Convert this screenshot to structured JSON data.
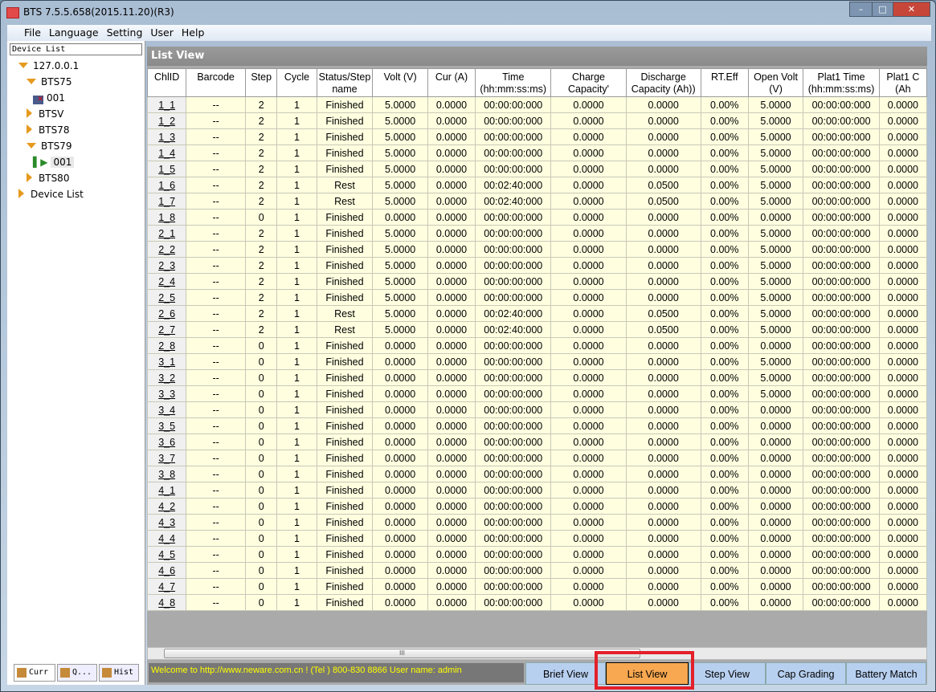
{
  "window": {
    "title": "BTS 7.5.5.658(2015.11.20)(R3)"
  },
  "menu": [
    "File",
    "Language",
    "Setting",
    "User",
    "Help"
  ],
  "sidebar": {
    "header": "Device List",
    "tree": [
      {
        "label": "127.0.0.1",
        "level": 0,
        "state": "expanded"
      },
      {
        "label": "BTS75",
        "level": 1,
        "state": "expanded"
      },
      {
        "label": "001",
        "level": 2,
        "state": "offline"
      },
      {
        "label": "BTSV",
        "level": 1,
        "state": "collapsed"
      },
      {
        "label": "BTS78",
        "level": 1,
        "state": "collapsed"
      },
      {
        "label": "BTS79",
        "level": 1,
        "state": "expanded"
      },
      {
        "label": "001",
        "level": 2,
        "state": "running-selected"
      },
      {
        "label": "BTS80",
        "level": 1,
        "state": "collapsed"
      },
      {
        "label": "Device List",
        "level": 0,
        "state": "collapsed"
      }
    ],
    "tabs": [
      "Curr",
      "Q...",
      "Hist"
    ]
  },
  "panel": {
    "title": "List View"
  },
  "table": {
    "columns": [
      "ChlID",
      "Barcode",
      "Step",
      "Cycle",
      "Status/Step name",
      "Volt (V)",
      "Cur (A)",
      "Time (hh:mm:ss:ms)",
      "Charge Capacity'",
      "Discharge Capacity (Ah))",
      "RT.Eff",
      "Open Volt (V)",
      "Plat1 Time (hh:mm:ss:ms)",
      "Plat1 C (Ah"
    ],
    "rows": [
      [
        "1_1",
        "--",
        "2",
        "1",
        "Finished",
        "5.0000",
        "0.0000",
        "00:00:00:000",
        "0.0000",
        "0.0000",
        "0.00%",
        "5.0000",
        "00:00:00:000",
        "0.0000"
      ],
      [
        "1_2",
        "--",
        "2",
        "1",
        "Finished",
        "5.0000",
        "0.0000",
        "00:00:00:000",
        "0.0000",
        "0.0000",
        "0.00%",
        "5.0000",
        "00:00:00:000",
        "0.0000"
      ],
      [
        "1_3",
        "--",
        "2",
        "1",
        "Finished",
        "5.0000",
        "0.0000",
        "00:00:00:000",
        "0.0000",
        "0.0000",
        "0.00%",
        "5.0000",
        "00:00:00:000",
        "0.0000"
      ],
      [
        "1_4",
        "--",
        "2",
        "1",
        "Finished",
        "5.0000",
        "0.0000",
        "00:00:00:000",
        "0.0000",
        "0.0000",
        "0.00%",
        "5.0000",
        "00:00:00:000",
        "0.0000"
      ],
      [
        "1_5",
        "--",
        "2",
        "1",
        "Finished",
        "5.0000",
        "0.0000",
        "00:00:00:000",
        "0.0000",
        "0.0000",
        "0.00%",
        "5.0000",
        "00:00:00:000",
        "0.0000"
      ],
      [
        "1_6",
        "--",
        "2",
        "1",
        "Rest",
        "5.0000",
        "0.0000",
        "00:02:40:000",
        "0.0000",
        "0.0500",
        "0.00%",
        "5.0000",
        "00:00:00:000",
        "0.0000"
      ],
      [
        "1_7",
        "--",
        "2",
        "1",
        "Rest",
        "5.0000",
        "0.0000",
        "00:02:40:000",
        "0.0000",
        "0.0500",
        "0.00%",
        "5.0000",
        "00:00:00:000",
        "0.0000"
      ],
      [
        "1_8",
        "--",
        "0",
        "1",
        "Finished",
        "0.0000",
        "0.0000",
        "00:00:00:000",
        "0.0000",
        "0.0000",
        "0.00%",
        "0.0000",
        "00:00:00:000",
        "0.0000"
      ],
      [
        "2_1",
        "--",
        "2",
        "1",
        "Finished",
        "5.0000",
        "0.0000",
        "00:00:00:000",
        "0.0000",
        "0.0000",
        "0.00%",
        "5.0000",
        "00:00:00:000",
        "0.0000"
      ],
      [
        "2_2",
        "--",
        "2",
        "1",
        "Finished",
        "5.0000",
        "0.0000",
        "00:00:00:000",
        "0.0000",
        "0.0000",
        "0.00%",
        "5.0000",
        "00:00:00:000",
        "0.0000"
      ],
      [
        "2_3",
        "--",
        "2",
        "1",
        "Finished",
        "5.0000",
        "0.0000",
        "00:00:00:000",
        "0.0000",
        "0.0000",
        "0.00%",
        "5.0000",
        "00:00:00:000",
        "0.0000"
      ],
      [
        "2_4",
        "--",
        "2",
        "1",
        "Finished",
        "5.0000",
        "0.0000",
        "00:00:00:000",
        "0.0000",
        "0.0000",
        "0.00%",
        "5.0000",
        "00:00:00:000",
        "0.0000"
      ],
      [
        "2_5",
        "--",
        "2",
        "1",
        "Finished",
        "5.0000",
        "0.0000",
        "00:00:00:000",
        "0.0000",
        "0.0000",
        "0.00%",
        "5.0000",
        "00:00:00:000",
        "0.0000"
      ],
      [
        "2_6",
        "--",
        "2",
        "1",
        "Rest",
        "5.0000",
        "0.0000",
        "00:02:40:000",
        "0.0000",
        "0.0500",
        "0.00%",
        "5.0000",
        "00:00:00:000",
        "0.0000"
      ],
      [
        "2_7",
        "--",
        "2",
        "1",
        "Rest",
        "5.0000",
        "0.0000",
        "00:02:40:000",
        "0.0000",
        "0.0500",
        "0.00%",
        "5.0000",
        "00:00:00:000",
        "0.0000"
      ],
      [
        "2_8",
        "--",
        "0",
        "1",
        "Finished",
        "0.0000",
        "0.0000",
        "00:00:00:000",
        "0.0000",
        "0.0000",
        "0.00%",
        "0.0000",
        "00:00:00:000",
        "0.0000"
      ],
      [
        "3_1",
        "--",
        "0",
        "1",
        "Finished",
        "0.0000",
        "0.0000",
        "00:00:00:000",
        "0.0000",
        "0.0000",
        "0.00%",
        "5.0000",
        "00:00:00:000",
        "0.0000"
      ],
      [
        "3_2",
        "--",
        "0",
        "1",
        "Finished",
        "0.0000",
        "0.0000",
        "00:00:00:000",
        "0.0000",
        "0.0000",
        "0.00%",
        "5.0000",
        "00:00:00:000",
        "0.0000"
      ],
      [
        "3_3",
        "--",
        "0",
        "1",
        "Finished",
        "0.0000",
        "0.0000",
        "00:00:00:000",
        "0.0000",
        "0.0000",
        "0.00%",
        "5.0000",
        "00:00:00:000",
        "0.0000"
      ],
      [
        "3_4",
        "--",
        "0",
        "1",
        "Finished",
        "0.0000",
        "0.0000",
        "00:00:00:000",
        "0.0000",
        "0.0000",
        "0.00%",
        "0.0000",
        "00:00:00:000",
        "0.0000"
      ],
      [
        "3_5",
        "--",
        "0",
        "1",
        "Finished",
        "0.0000",
        "0.0000",
        "00:00:00:000",
        "0.0000",
        "0.0000",
        "0.00%",
        "0.0000",
        "00:00:00:000",
        "0.0000"
      ],
      [
        "3_6",
        "--",
        "0",
        "1",
        "Finished",
        "0.0000",
        "0.0000",
        "00:00:00:000",
        "0.0000",
        "0.0000",
        "0.00%",
        "0.0000",
        "00:00:00:000",
        "0.0000"
      ],
      [
        "3_7",
        "--",
        "0",
        "1",
        "Finished",
        "0.0000",
        "0.0000",
        "00:00:00:000",
        "0.0000",
        "0.0000",
        "0.00%",
        "0.0000",
        "00:00:00:000",
        "0.0000"
      ],
      [
        "3_8",
        "--",
        "0",
        "1",
        "Finished",
        "0.0000",
        "0.0000",
        "00:00:00:000",
        "0.0000",
        "0.0000",
        "0.00%",
        "0.0000",
        "00:00:00:000",
        "0.0000"
      ],
      [
        "4_1",
        "--",
        "0",
        "1",
        "Finished",
        "0.0000",
        "0.0000",
        "00:00:00:000",
        "0.0000",
        "0.0000",
        "0.00%",
        "0.0000",
        "00:00:00:000",
        "0.0000"
      ],
      [
        "4_2",
        "--",
        "0",
        "1",
        "Finished",
        "0.0000",
        "0.0000",
        "00:00:00:000",
        "0.0000",
        "0.0000",
        "0.00%",
        "0.0000",
        "00:00:00:000",
        "0.0000"
      ],
      [
        "4_3",
        "--",
        "0",
        "1",
        "Finished",
        "0.0000",
        "0.0000",
        "00:00:00:000",
        "0.0000",
        "0.0000",
        "0.00%",
        "0.0000",
        "00:00:00:000",
        "0.0000"
      ],
      [
        "4_4",
        "--",
        "0",
        "1",
        "Finished",
        "0.0000",
        "0.0000",
        "00:00:00:000",
        "0.0000",
        "0.0000",
        "0.00%",
        "0.0000",
        "00:00:00:000",
        "0.0000"
      ],
      [
        "4_5",
        "--",
        "0",
        "1",
        "Finished",
        "0.0000",
        "0.0000",
        "00:00:00:000",
        "0.0000",
        "0.0000",
        "0.00%",
        "0.0000",
        "00:00:00:000",
        "0.0000"
      ],
      [
        "4_6",
        "--",
        "0",
        "1",
        "Finished",
        "0.0000",
        "0.0000",
        "00:00:00:000",
        "0.0000",
        "0.0000",
        "0.00%",
        "0.0000",
        "00:00:00:000",
        "0.0000"
      ],
      [
        "4_7",
        "--",
        "0",
        "1",
        "Finished",
        "0.0000",
        "0.0000",
        "00:00:00:000",
        "0.0000",
        "0.0000",
        "0.00%",
        "0.0000",
        "00:00:00:000",
        "0.0000"
      ],
      [
        "4_8",
        "--",
        "0",
        "1",
        "Finished",
        "0.0000",
        "0.0000",
        "00:00:00:000",
        "0.0000",
        "0.0000",
        "0.00%",
        "0.0000",
        "00:00:00:000",
        "0.0000"
      ]
    ]
  },
  "statusbar": {
    "text": "Welcome to http://www.neware.com.cn !    (Tel ) 800-830 8866  User name: admin"
  },
  "views": {
    "items": [
      "Brief View",
      "List View",
      "Step View",
      "Cap Grading",
      "Battery Match"
    ],
    "active": "List View",
    "active_color": "#f8a850",
    "highlight_color": "#e3202a"
  }
}
